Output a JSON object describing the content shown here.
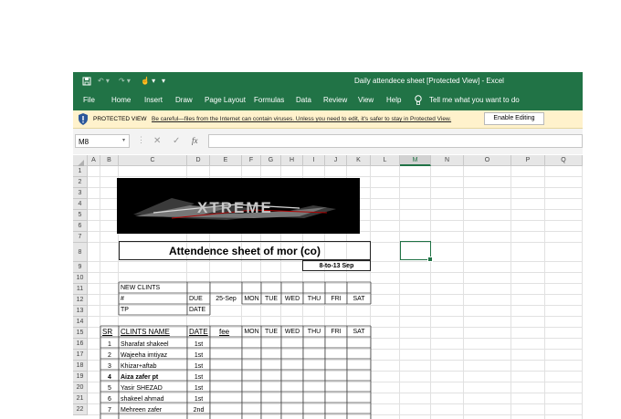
{
  "window": {
    "title": "Daily attendece sheet  [Protected View]  -  Excel"
  },
  "menu": {
    "items": [
      "File",
      "Home",
      "Insert",
      "Draw",
      "Page Layout",
      "Formulas",
      "Data",
      "Review",
      "View",
      "Help"
    ],
    "tell_me": "Tell me what you want to do"
  },
  "protected_view": {
    "label": "PROTECTED VIEW",
    "message": "Be careful—files from the Internet can contain viruses. Unless you need to edit, it's safer to stay in Protected View.",
    "button": "Enable Editing"
  },
  "formula_bar": {
    "name_box": "M8",
    "fx": "fx",
    "value": ""
  },
  "columns": [
    "A",
    "B",
    "C",
    "D",
    "E",
    "F",
    "G",
    "H",
    "I",
    "J",
    "K",
    "L",
    "M",
    "N",
    "O",
    "P",
    "Q"
  ],
  "selected_column": "M",
  "rows": [
    "1",
    "2",
    "3",
    "4",
    "5",
    "6",
    "7",
    "8",
    "9",
    "10",
    "11",
    "12",
    "13",
    "14",
    "15",
    "16",
    "17",
    "18",
    "19",
    "20",
    "21",
    "22"
  ],
  "sheet": {
    "logo_text": "XTREME",
    "title": "Attendence sheet of mor (co)",
    "date_range": "8-to-13 Sep",
    "info_block": {
      "new_clints": "NEW CLINTS",
      "hash": "#",
      "tp": "TP",
      "due": "DUE",
      "date": "DATE",
      "day_headers": [
        "25-Sep",
        "MON",
        "TUE",
        "WED",
        "THU",
        "FRI",
        "SAT"
      ]
    },
    "table_headers": {
      "sr": "SR",
      "name": "CLINTS NAME",
      "date": "DATE",
      "fee": "fee",
      "days": [
        "MON",
        "TUE",
        "WED",
        "THU",
        "FRI",
        "SAT"
      ]
    },
    "clients": [
      {
        "sr": "1",
        "name": "Sharafat shakeel",
        "date": "1st",
        "bold": false
      },
      {
        "sr": "2",
        "name": "Wajeeha imtiyaz",
        "date": "1st",
        "bold": false
      },
      {
        "sr": "3",
        "name": "Khizar+aftab",
        "date": "1st",
        "bold": false
      },
      {
        "sr": "4",
        "name": "Aiza zafer pt",
        "date": "1st",
        "bold": true
      },
      {
        "sr": "5",
        "name": "Yasir SHEZAD",
        "date": "1st",
        "bold": false
      },
      {
        "sr": "6",
        "name": "shakeel ahmad",
        "date": "1st",
        "bold": false
      },
      {
        "sr": "7",
        "name": "Mehreen zafer",
        "date": "2nd",
        "bold": false
      }
    ]
  },
  "colors": {
    "excel_green": "#217346",
    "protected_bg": "#fff2cc",
    "selection": "#217346"
  }
}
